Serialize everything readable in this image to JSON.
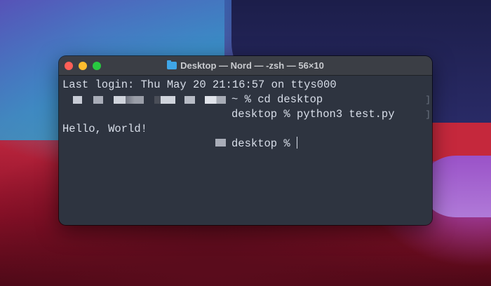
{
  "window": {
    "title": "Desktop — Nord — -zsh — 56×10",
    "title_icon": "folder-icon",
    "traffic_lights": {
      "close": "#ff5f57",
      "minimize": "#febc2e",
      "zoom": "#28c840"
    }
  },
  "terminal": {
    "lines": [
      "Last login: Thu May 20 21:16:57 on ttys000",
      "~ % cd desktop",
      "desktop % python3 test.py",
      "Hello, World!",
      "desktop %"
    ],
    "bracket": "]"
  },
  "colors": {
    "background": "#2e3440",
    "foreground": "#d8dee9"
  }
}
